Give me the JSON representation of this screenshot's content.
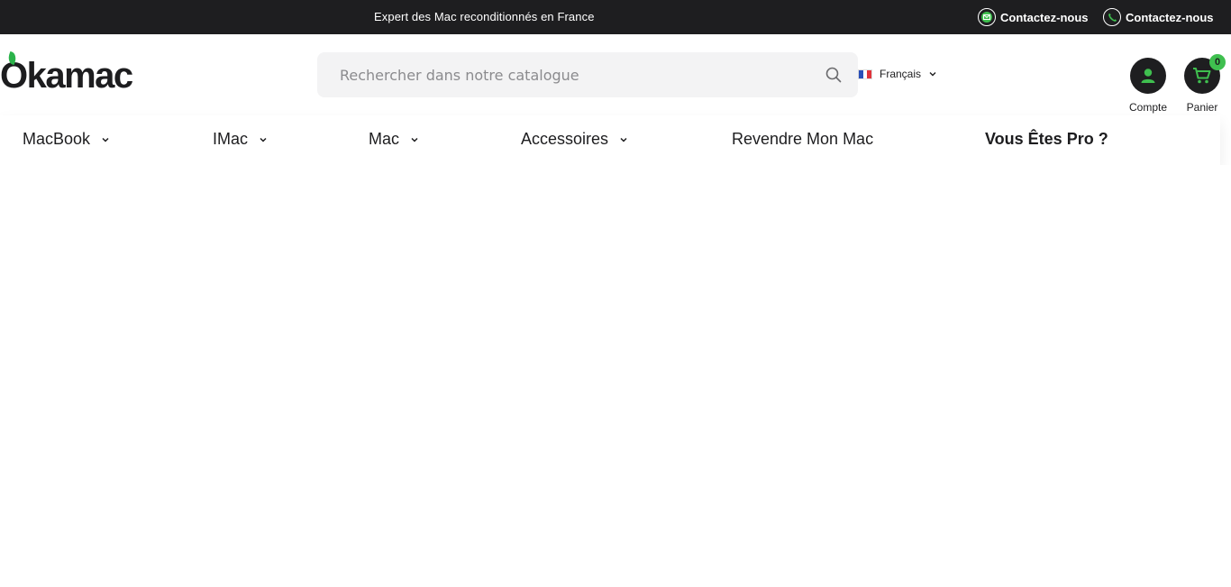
{
  "topbar": {
    "message": "Expert des Mac reconditionnés en France",
    "contact_email_label": "Contactez-nous",
    "contact_phone_label": "Contactez-nous",
    "icons": [
      "mail-icon",
      "phone-icon"
    ]
  },
  "header": {
    "logo_text": "Okamac",
    "search": {
      "placeholder": "Rechercher dans notre catalogue",
      "value": ""
    },
    "language": {
      "selected": "Français"
    },
    "account_label": "Compte",
    "cart_label": "Panier",
    "cart_count": "0"
  },
  "nav": {
    "items": [
      {
        "label": "MacBook"
      },
      {
        "label": "IMac"
      },
      {
        "label": "Mac"
      },
      {
        "label": "Accessoires"
      },
      {
        "label": "Revendre Mon Mac"
      },
      {
        "label": "Vous Êtes Pro ?"
      }
    ]
  },
  "colors": {
    "topbar_bg": "#1e1e20",
    "accent_green": "#3fbf4f",
    "search_bg": "#f3f3f4"
  }
}
